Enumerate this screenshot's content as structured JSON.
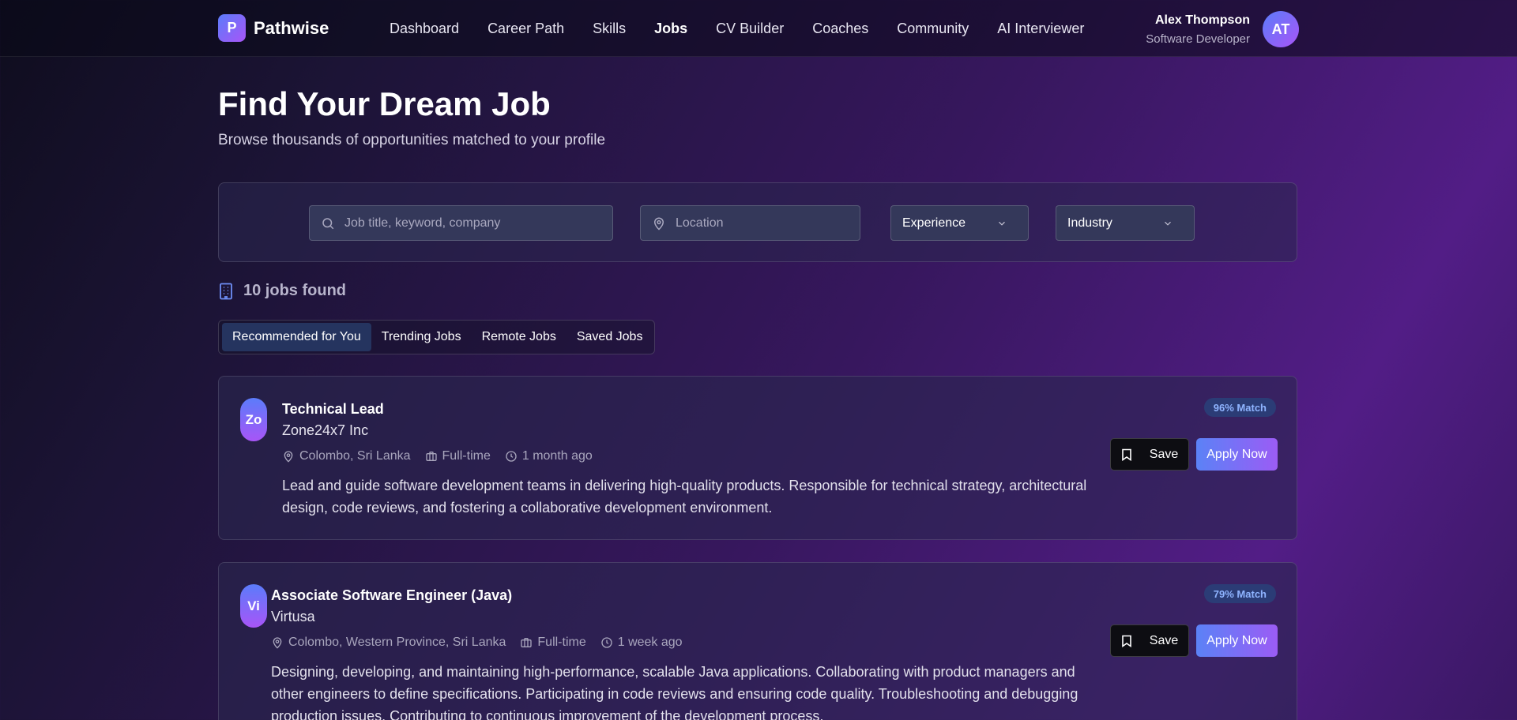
{
  "app": {
    "logo_letter": "P",
    "name": "Pathwise"
  },
  "nav": {
    "items": [
      {
        "label": "Dashboard"
      },
      {
        "label": "Career Path"
      },
      {
        "label": "Skills"
      },
      {
        "label": "Jobs",
        "active": true
      },
      {
        "label": "CV Builder"
      },
      {
        "label": "Coaches"
      },
      {
        "label": "Community"
      },
      {
        "label": "AI Interviewer"
      }
    ]
  },
  "user": {
    "name": "Alex Thompson",
    "role": "Software Developer",
    "initials": "AT"
  },
  "page": {
    "title": "Find Your Dream Job",
    "subtitle": "Browse thousands of opportunities matched to your profile"
  },
  "search": {
    "keyword_placeholder": "Job title, keyword, company",
    "location_placeholder": "Location",
    "experience_label": "Experience",
    "industry_label": "Industry"
  },
  "results": {
    "count_text": "10 jobs found"
  },
  "tabs": [
    {
      "label": "Recommended for You",
      "active": true
    },
    {
      "label": "Trending Jobs"
    },
    {
      "label": "Remote Jobs"
    },
    {
      "label": "Saved Jobs"
    }
  ],
  "jobs": [
    {
      "logo": "Zo",
      "title": "Technical Lead",
      "company": "Zone24x7 Inc",
      "location": "Colombo, Sri Lanka",
      "type": "Full-time",
      "posted": "1 month ago",
      "description": "Lead and guide software development teams in delivering high-quality products. Responsible for technical strategy, architectural design, code reviews, and fostering a collaborative development environment.",
      "match": "96% Match",
      "save_label": "Save",
      "apply_label": "Apply Now"
    },
    {
      "logo": "Vi",
      "title": "Associate Software Engineer (Java)",
      "company": "Virtusa",
      "location": "Colombo, Western Province, Sri Lanka",
      "type": "Full-time",
      "posted": "1 week ago",
      "description": "Designing, developing, and maintaining high-performance, scalable Java applications. Collaborating with product managers and other engineers to define specifications. Participating in code reviews and ensuring code quality. Troubleshooting and debugging production issues. Contributing to continuous improvement of the development process.",
      "match": "79% Match",
      "save_label": "Save",
      "apply_label": "Apply Now"
    }
  ],
  "colors": {
    "accent_start": "#5b82f6",
    "accent_end": "#9b5cf5",
    "match_text": "#8fb4ff"
  }
}
